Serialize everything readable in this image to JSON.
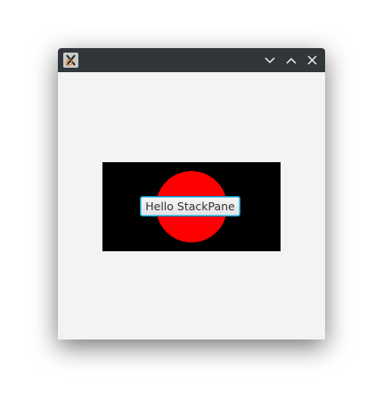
{
  "titlebar": {
    "app_icon": "x-window-icon",
    "controls": [
      {
        "name": "minimize",
        "icon": "chevron-down-icon"
      },
      {
        "name": "maximize",
        "icon": "chevron-up-icon"
      },
      {
        "name": "close",
        "icon": "close-icon"
      }
    ]
  },
  "content": {
    "button_label": "Hello StackPane",
    "colors": {
      "background": "#000000",
      "circle": "#ff0000",
      "pane": "#f3f3f3"
    }
  }
}
